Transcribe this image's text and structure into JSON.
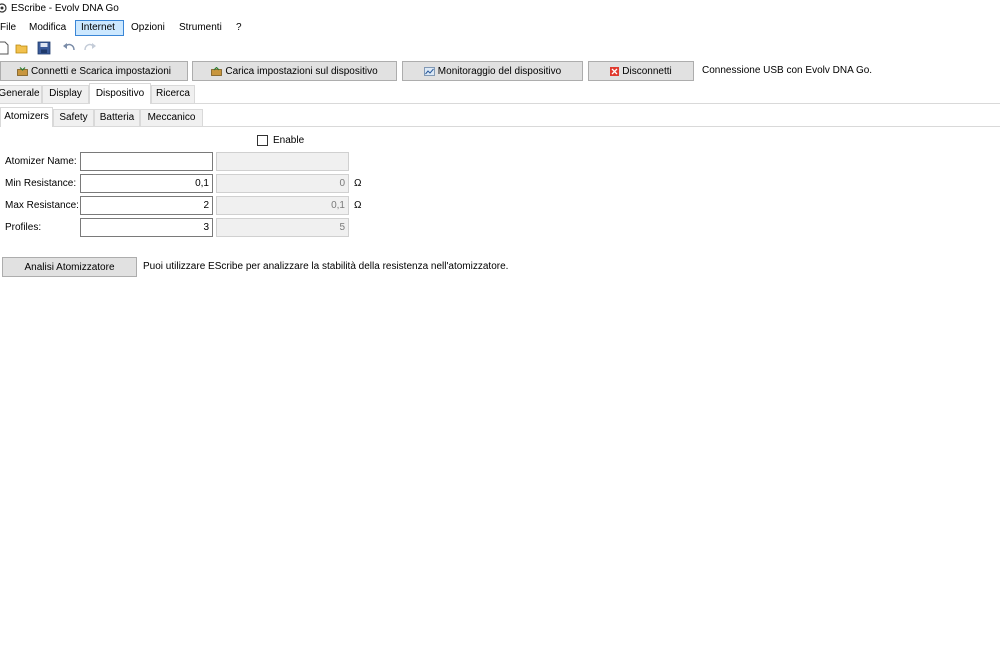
{
  "window": {
    "title": "EScribe - Evolv DNA Go"
  },
  "menu": {
    "items": [
      "File",
      "Modifica",
      "Internet",
      "Opzioni",
      "Strumenti",
      "?"
    ],
    "active": "Internet"
  },
  "toolbar": {
    "icons": [
      "new-file-icon",
      "open-folder-icon",
      "save-icon",
      "undo-icon",
      "redo-icon"
    ]
  },
  "actions": {
    "connect_download": "Connetti e Scarica impostazioni",
    "upload": "Carica impostazioni sul dispositivo",
    "monitor": "Monitoraggio del dispositivo",
    "disconnect": "Disconnetti",
    "status": "Connessione USB con Evolv DNA Go."
  },
  "tabs": {
    "main": [
      "Generale",
      "Display",
      "Dispositivo",
      "Ricerca"
    ],
    "main_selected": "Dispositivo",
    "sub": [
      "Atomizers",
      "Safety",
      "Batteria",
      "Meccanico"
    ],
    "sub_selected": "Atomizers"
  },
  "form": {
    "enable_label": "Enable",
    "enable_checked": false,
    "atomizer_name_label": "Atomizer Name:",
    "atomizer_name_value": "",
    "atomizer_name_ro": "",
    "min_res_label": "Min Resistance:",
    "min_res_value": "0,1",
    "min_res_ro": "0",
    "max_res_label": "Max Resistance:",
    "max_res_value": "2",
    "max_res_ro": "0,1",
    "profiles_label": "Profiles:",
    "profiles_value": "3",
    "profiles_ro": "5",
    "unit_ohm": "Ω"
  },
  "analysis": {
    "button": "Analisi Atomizzatore",
    "description": "Puoi utilizzare EScribe per analizzare la stabilità della resistenza nell'atomizzatore."
  },
  "colors": {
    "menu_active_bg": "#cce8ff",
    "menu_active_border": "#3a86d6",
    "button_bg": "#e1e1e1",
    "disconnect_icon": "#e03a2f"
  }
}
